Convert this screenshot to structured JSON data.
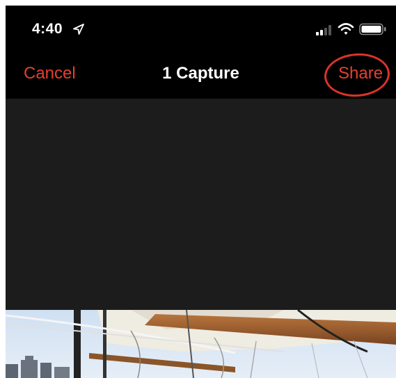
{
  "status_bar": {
    "time": "4:40",
    "icons": [
      "location-arrow-icon",
      "cellular-signal-icon",
      "wifi-icon",
      "battery-icon"
    ]
  },
  "nav": {
    "cancel_label": "Cancel",
    "title": "1 Capture",
    "share_label": "Share"
  },
  "colors": {
    "accent": "#e5402f",
    "highlight_ring": "#d9342a",
    "background": "#000000",
    "content_bg": "#1c1c1c"
  }
}
